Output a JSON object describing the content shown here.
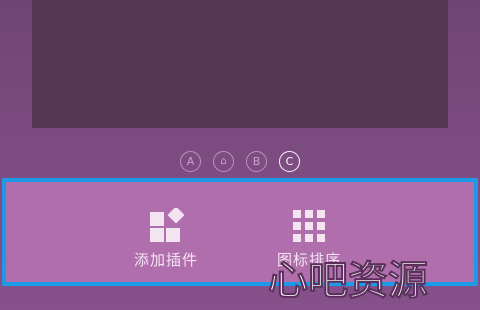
{
  "page_dots": [
    {
      "label": "A",
      "active": false
    },
    {
      "label": "⌂",
      "active": false
    },
    {
      "label": "B",
      "active": false
    },
    {
      "label": "C",
      "active": true
    }
  ],
  "dock": {
    "items": [
      {
        "label": "添加插件",
        "icon": "add-widget-icon"
      },
      {
        "label": "图标排序",
        "icon": "icon-grid-icon"
      }
    ]
  },
  "watermark": "心吧资源",
  "colors": {
    "background": "#7b4a7e",
    "preview": "#553655",
    "dock": "#b06eac",
    "highlight_border": "#1c9ae8"
  }
}
